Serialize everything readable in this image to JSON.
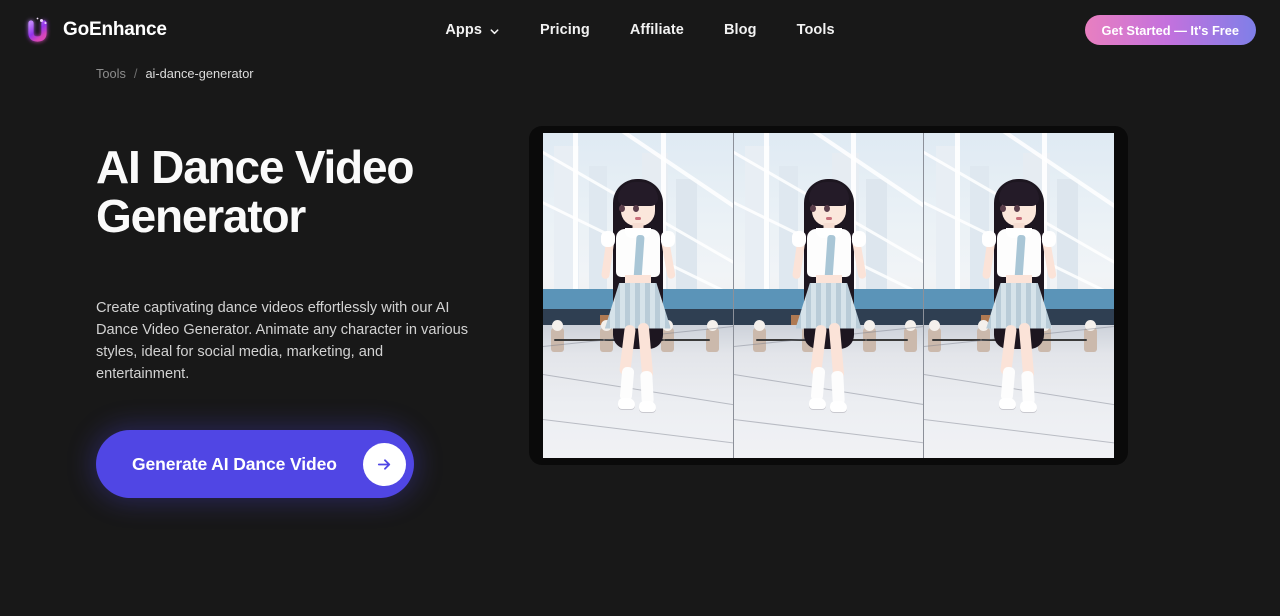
{
  "brand": {
    "name": "GoEnhance",
    "logo_icon": "sparkle-u-logo-icon",
    "accent": "#a855f7"
  },
  "header": {
    "nav": [
      {
        "label": "Apps",
        "has_dropdown": true,
        "icon": "chevron-down-icon"
      },
      {
        "label": "Pricing",
        "has_dropdown": false
      },
      {
        "label": "Affiliate",
        "has_dropdown": false
      },
      {
        "label": "Blog",
        "has_dropdown": false
      },
      {
        "label": "Tools",
        "has_dropdown": false
      }
    ],
    "cta_label": "Get Started — It's Free",
    "cta_gradient_from": "#e87fc0",
    "cta_gradient_to": "#7f7fe8"
  },
  "breadcrumb": {
    "root": "Tools",
    "separator": "/",
    "current": "ai-dance-generator"
  },
  "hero": {
    "title": "AI Dance Video\nGenerator",
    "description": "Create captivating dance videos effortlessly with our AI Dance Video Generator. Animate any character in various styles, ideal for social media, marketing, and entertainment.",
    "cta_label": "Generate AI Dance Video",
    "cta_icon": "arrow-right-icon",
    "cta_color": "#5046e4"
  },
  "preview": {
    "name": "dance-video-preview",
    "frame_count": 3,
    "frames": [
      {
        "alt": "anime girl dancing on bridge frame 1"
      },
      {
        "alt": "anime girl dancing on bridge frame 2"
      },
      {
        "alt": "anime girl dancing on bridge frame 3"
      }
    ]
  },
  "theme": {
    "background": "#181818",
    "text_primary": "#fafafa",
    "text_secondary": "#d2d2d2",
    "text_muted": "#8d8d8d"
  }
}
